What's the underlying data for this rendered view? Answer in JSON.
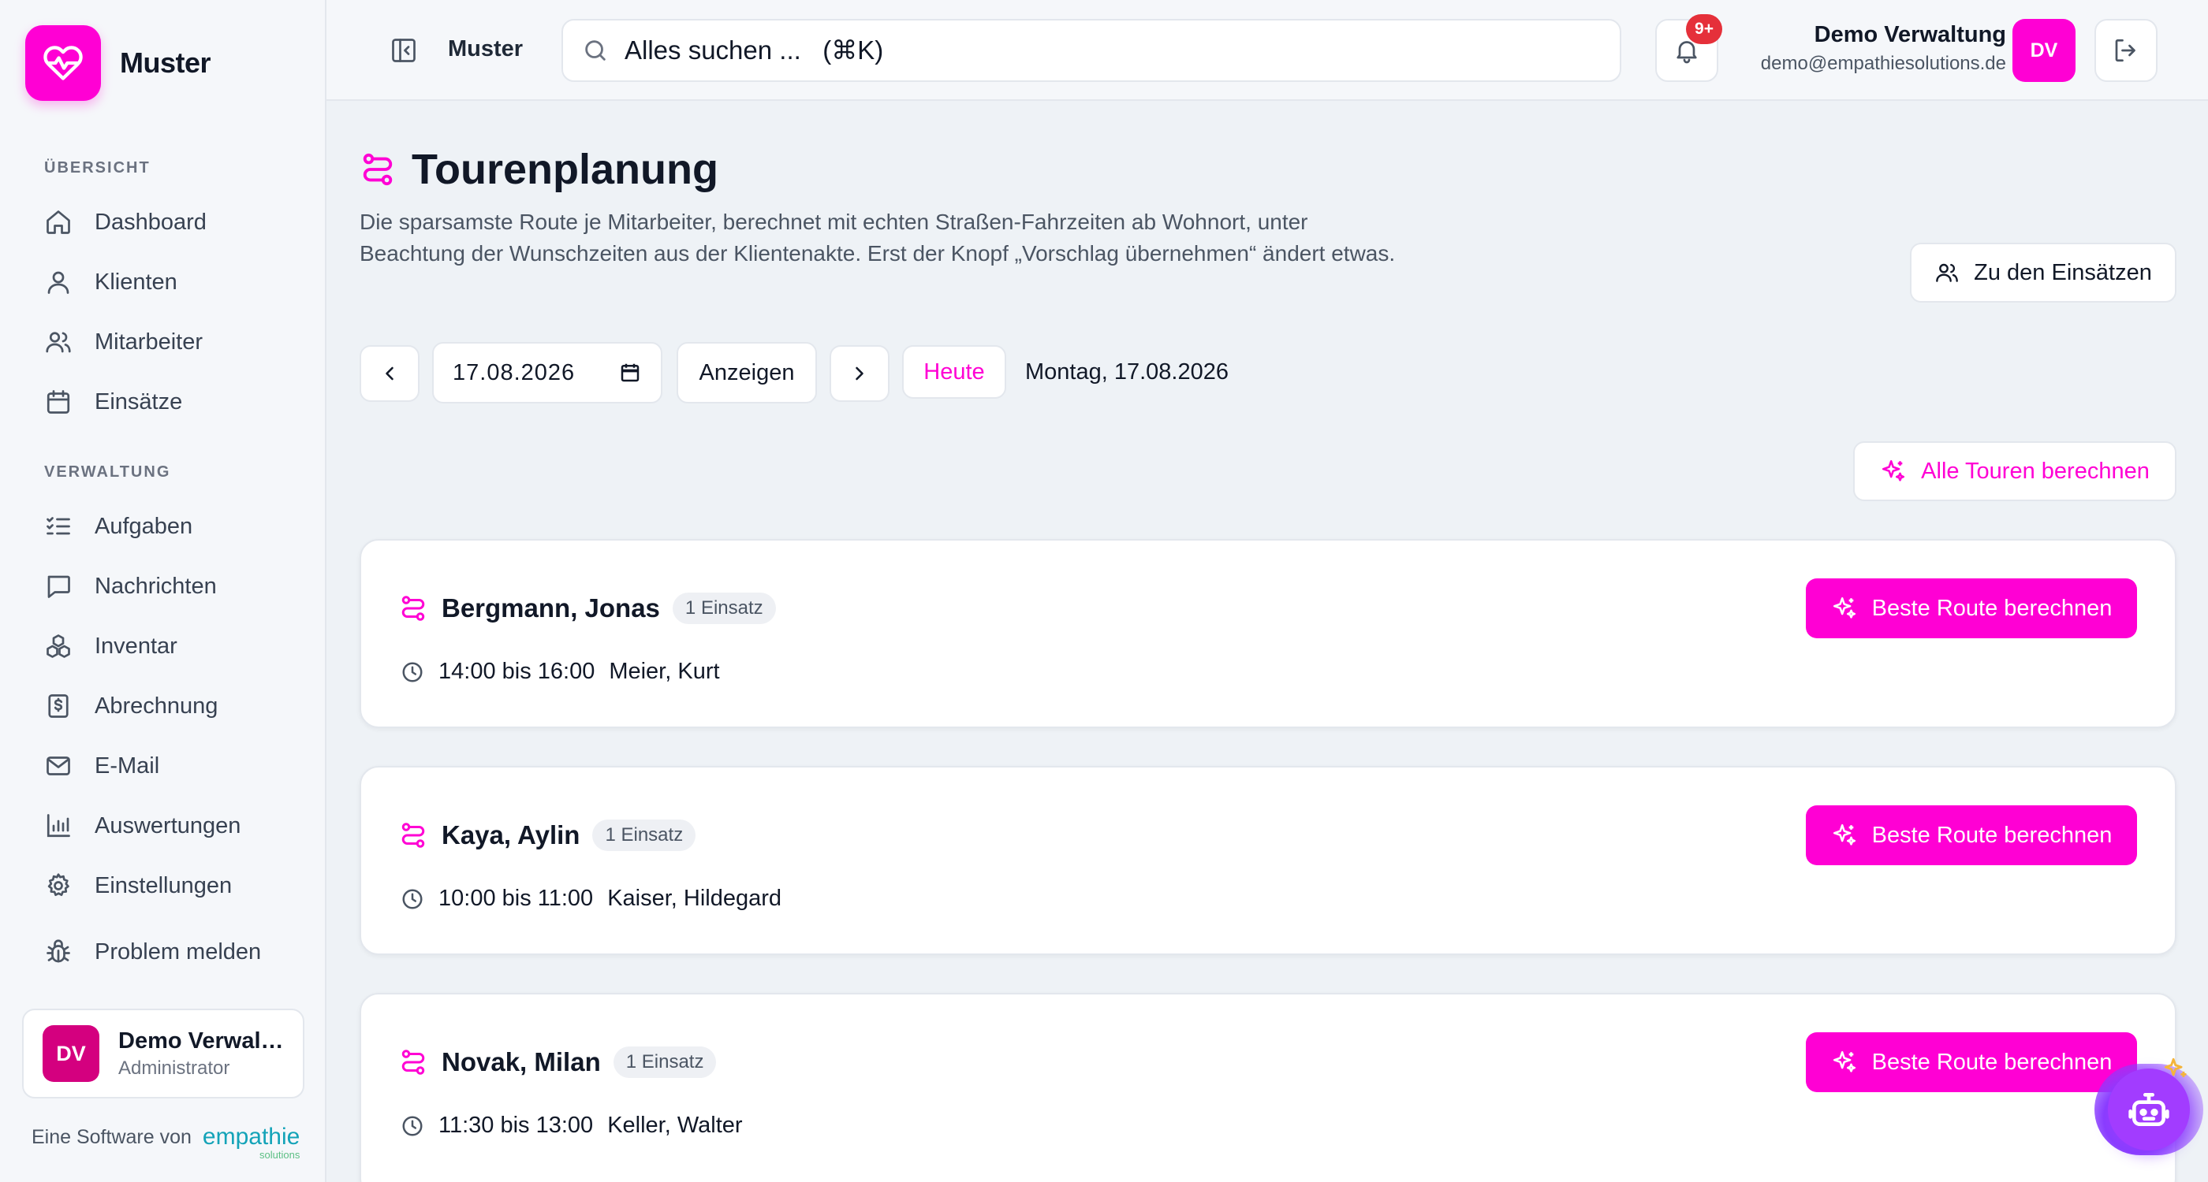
{
  "app": {
    "brand_name": "Muster",
    "accent_color": "#ff00d4"
  },
  "sidebar": {
    "section_overview": "ÜBERSICHT",
    "section_admin": "VERWALTUNG",
    "items": [
      {
        "label": "Dashboard",
        "icon": "home-icon"
      },
      {
        "label": "Klienten",
        "icon": "user-icon"
      },
      {
        "label": "Mitarbeiter",
        "icon": "users-icon"
      },
      {
        "label": "Einsätze",
        "icon": "calendar-icon"
      },
      {
        "label": "Aufgaben",
        "icon": "checklist-icon"
      },
      {
        "label": "Nachrichten",
        "icon": "message-icon"
      },
      {
        "label": "Inventar",
        "icon": "boxes-icon"
      },
      {
        "label": "Abrechnung",
        "icon": "invoice-icon"
      },
      {
        "label": "E-Mail",
        "icon": "mail-icon"
      },
      {
        "label": "Auswertungen",
        "icon": "bar-chart-icon"
      },
      {
        "label": "Einstellungen",
        "icon": "gear-icon"
      },
      {
        "label": "Problem melden",
        "icon": "bug-icon"
      }
    ],
    "user": {
      "initials": "DV",
      "name": "Demo Verwaltung",
      "role": "Administrator"
    },
    "powered_by": "Eine Software von",
    "vendor_logo": "empathie",
    "vendor_logo_sub": "solutions"
  },
  "topbar": {
    "title": "Muster",
    "search_placeholder": "Alles suchen ...   (⌘K)",
    "notification_count": "9+",
    "user_name": "Demo Verwaltung",
    "user_email": "demo@empathiesolutions.de",
    "user_initials": "DV"
  },
  "page": {
    "title": "Tourenplanung",
    "description": "Die sparsamste Route je Mitarbeiter, berechnet mit echten Straßen-Fahrzeiten ab Wohnort, unter Beachtung der Wunschzeiten aus der Klientenakte. Erst der Knopf „Vorschlag übernehmen“ ändert etwas.",
    "goto_assignments_label": "Zu den Einsätzen",
    "date_value": "17.08.2026",
    "show_label": "Anzeigen",
    "today_label": "Heute",
    "date_display": "Montag, 17.08.2026",
    "compute_all_label": "Alle Touren berechnen"
  },
  "tours": [
    {
      "employee": "Bergmann, Jonas",
      "badge": "1 Einsatz",
      "time": "14:00 bis 16:00",
      "client": "Meier, Kurt",
      "button": "Beste Route berechnen"
    },
    {
      "employee": "Kaya, Aylin",
      "badge": "1 Einsatz",
      "time": "10:00 bis 11:00",
      "client": "Kaiser, Hildegard",
      "button": "Beste Route berechnen"
    },
    {
      "employee": "Novak, Milan",
      "badge": "1 Einsatz",
      "time": "11:30 bis 13:00",
      "client": "Keller, Walter",
      "button": "Beste Route berechnen"
    }
  ]
}
